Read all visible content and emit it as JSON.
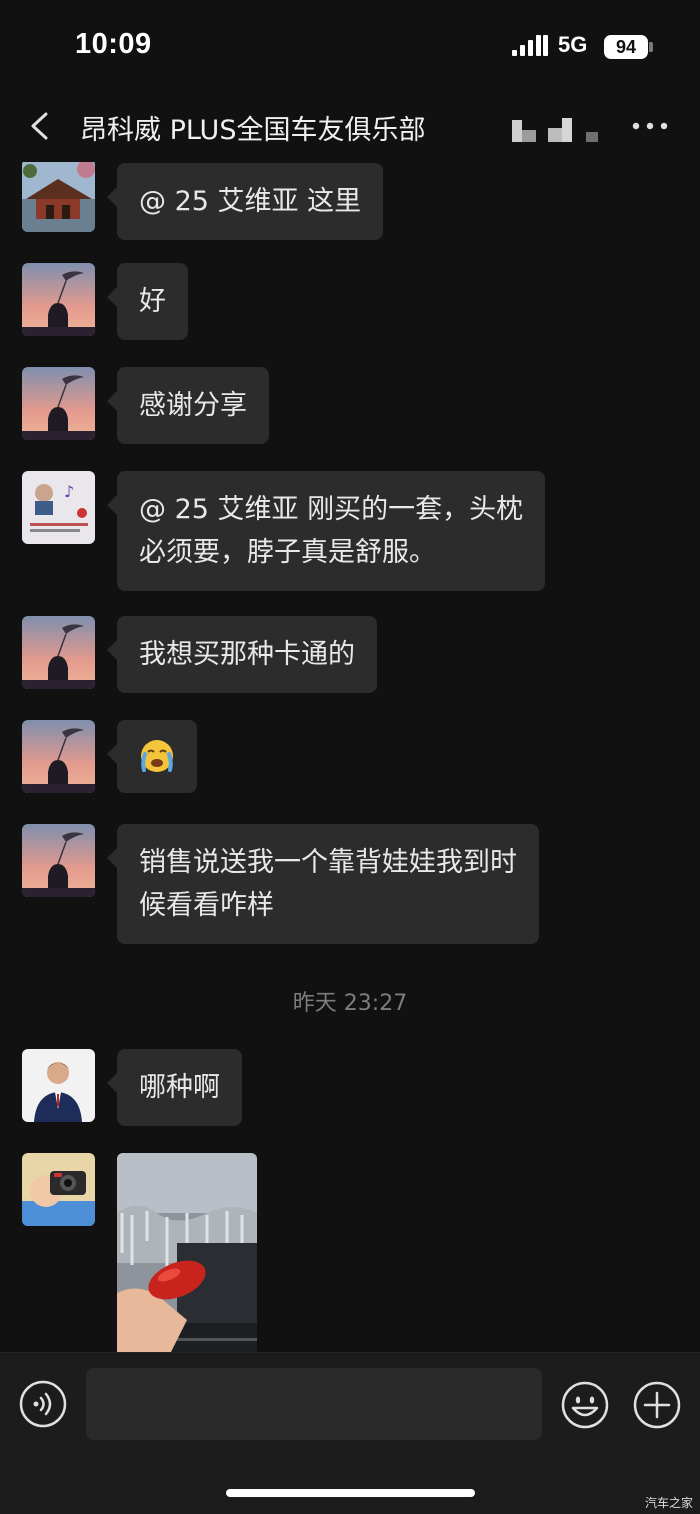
{
  "status_bar": {
    "time": "10:09",
    "network": "5G",
    "battery": "94"
  },
  "header": {
    "title": "昂科威 PLUS全国车友俱乐部",
    "back_icon": "chevron-left-icon",
    "more_icon": "more-dots-icon"
  },
  "messages": [
    {
      "sender_avatar": "pagoda-avatar",
      "text_lines": [
        "@ 25 艾维亚 这里"
      ]
    },
    {
      "sender_avatar": "silhouette-sunset-avatar",
      "text_lines": [
        "好"
      ]
    },
    {
      "sender_avatar": "silhouette-sunset-avatar",
      "text_lines": [
        "感谢分享"
      ]
    },
    {
      "sender_avatar": "sticker-photo-avatar",
      "text_lines": [
        "@ 25 艾维亚 刚买的一套，头枕",
        "必须要，脖子真是舒服。"
      ]
    },
    {
      "sender_avatar": "silhouette-sunset-avatar",
      "text_lines": [
        "我想买那种卡通的"
      ]
    },
    {
      "sender_avatar": "silhouette-sunset-avatar",
      "emoji": "😭"
    },
    {
      "sender_avatar": "silhouette-sunset-avatar",
      "text_lines": [
        "销售说送我一个靠背娃娃我到时",
        "候看看咋样"
      ]
    },
    {
      "timestamp": "昨天 23:27"
    },
    {
      "sender_avatar": "businessman-avatar",
      "text_lines": [
        "哪种啊"
      ]
    },
    {
      "sender_avatar": "cartoon-camera-avatar",
      "image": "car-window-cleaning-photo"
    }
  ],
  "input_bar": {
    "voice_icon": "voice-icon",
    "emoji_icon": "emoji-icon",
    "plus_icon": "plus-icon"
  },
  "watermark": "汽车之家",
  "colors": {
    "background": "#111111",
    "bubble": "#2c2c2c",
    "input_bar": "#1c1c1c",
    "text": "#e8e8e8"
  }
}
